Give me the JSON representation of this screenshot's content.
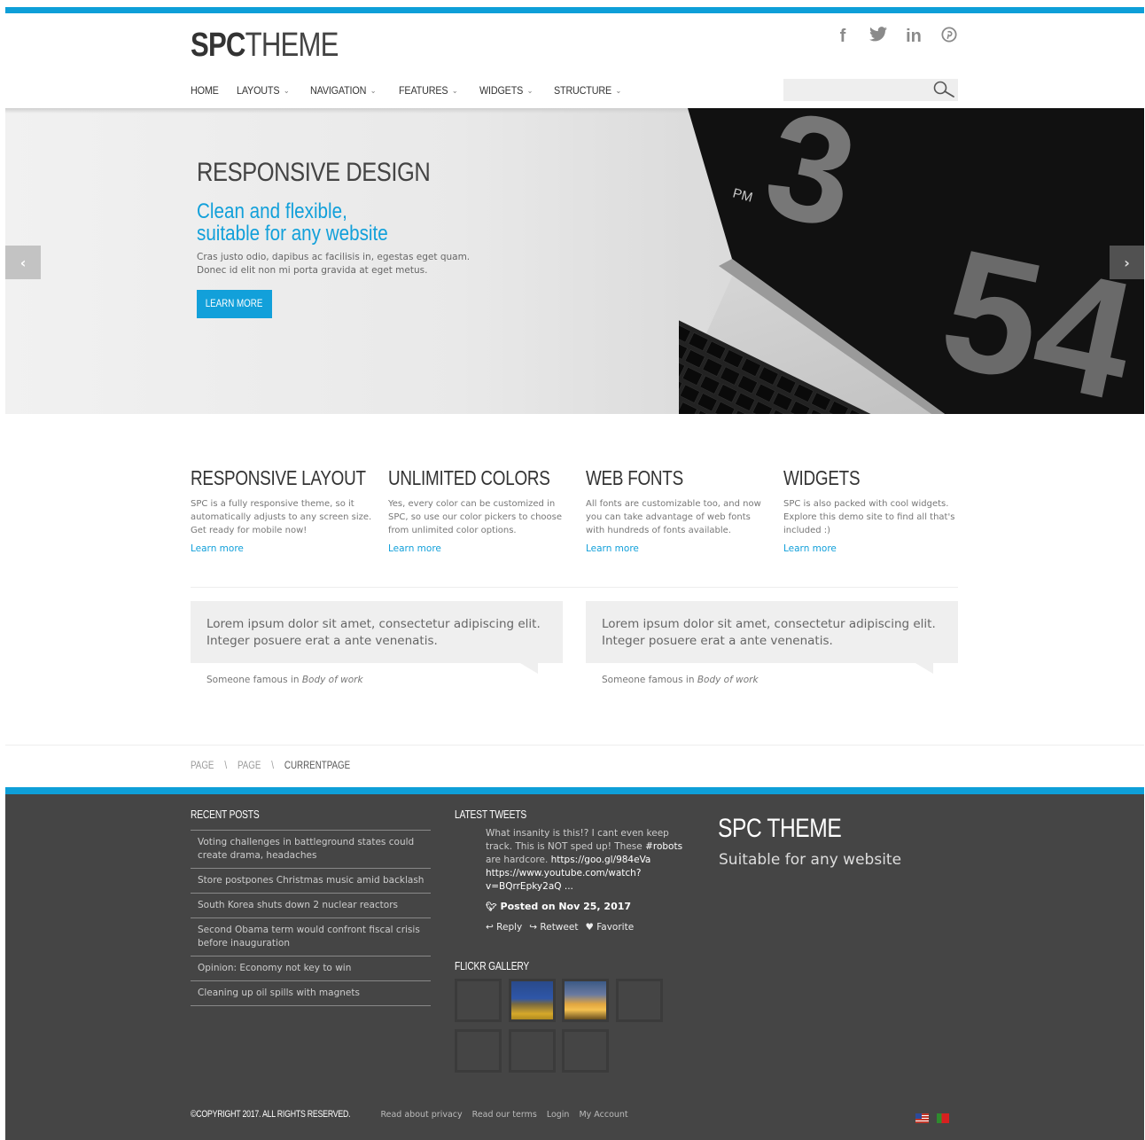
{
  "header": {
    "logo_bold": "SPC",
    "logo_light": "THEME",
    "social": [
      "facebook-icon",
      "twitter-icon",
      "linkedin-icon",
      "pinterest-icon"
    ],
    "social_glyphs": [
      "f",
      "𝕥",
      "in",
      "℗"
    ],
    "nav": [
      {
        "label": "HOME",
        "dropdown": false
      },
      {
        "label": "LAYOUTS",
        "dropdown": true
      },
      {
        "label": "NAVIGATION",
        "dropdown": true
      },
      {
        "label": "FEATURES",
        "dropdown": true
      },
      {
        "label": "WIDGETS",
        "dropdown": true
      },
      {
        "label": "STRUCTURE",
        "dropdown": true
      }
    ],
    "search_placeholder": ""
  },
  "hero": {
    "title": "RESPONSIVE DESIGN",
    "subtitle_line1": "Clean and flexible,",
    "subtitle_line2": "suitable for any website",
    "text_line1": "Cras justo odio, dapibus ac facilisis in, egestas eget quam.",
    "text_line2": "Donec id elit non mi porta gravida at eget metus.",
    "button": "LEARN MORE",
    "prev": "‹",
    "next": "›",
    "laptop_digits": [
      "3",
      "54"
    ],
    "laptop_pm": "PM"
  },
  "features": [
    {
      "title": "RESPONSIVE LAYOUT",
      "text": "SPC is a fully responsive theme, so it automatically adjusts to any screen size. Get ready for mobile now!",
      "link": "Learn more"
    },
    {
      "title": "UNLIMITED COLORS",
      "text": "Yes, every color can be customized in SPC, so use our color pickers to choose from unlimited color options.",
      "link": "Learn more"
    },
    {
      "title": "WEB FONTS",
      "text": "All fonts are customizable too, and now you can take advantage of web fonts with hundreds of fonts available.",
      "link": "Learn more"
    },
    {
      "title": "WIDGETS",
      "text": "SPC is also packed with cool widgets. Explore this demo site to find all that's included :)",
      "link": "Learn more"
    }
  ],
  "quotes": [
    {
      "text": "Lorem ipsum dolor sit amet, consectetur adipiscing elit. Integer posuere erat a ante venenatis.",
      "author": "Someone famous in",
      "source": "Body of work"
    },
    {
      "text": "Lorem ipsum dolor sit amet, consectetur adipiscing elit. Integer posuere erat a ante venenatis.",
      "author": "Someone famous in",
      "source": "Body of work"
    }
  ],
  "breadcrumb": [
    "PAGE",
    "\\",
    "PAGE",
    "\\",
    "CURRENTPAGE"
  ],
  "footer": {
    "recent_posts_title": "RECENT POSTS",
    "recent_posts": [
      "Voting challenges in battleground states could create drama, headaches",
      "Store postpones Christmas music amid backlash",
      "South Korea shuts down 2 nuclear reactors",
      "Second Obama term would confront fiscal crisis before inauguration",
      "Opinion: Economy not key to win",
      "Cleaning up oil spills with magnets"
    ],
    "latest_tweets_title": "LATEST TWEETS",
    "tweet_text": "What insanity is this!? I cant even keep track. This is NOT sped up! These",
    "tweet_tag": "#robots",
    "tweet_text2": "are hardcore.",
    "tweet_link1": "https://goo.gl/984eVa",
    "tweet_link2": "https://www.youtube.com/watch?v=BQrrEpky2aQ ...",
    "tweet_posted": "Posted on Nov 25, 2017",
    "tweet_reply": "Reply",
    "tweet_retweet": "Retweet",
    "tweet_favorite": "Favorite",
    "flickr_title": "FLICKR GALLERY",
    "brand": "SPC THEME",
    "tagline": "Suitable for any website",
    "copyright": "©COPYRIGHT 2017. ALL RIGHTS RESERVED.",
    "links": [
      "Read about privacy",
      "Read our terms",
      "Login",
      "My Account"
    ]
  },
  "colors": {
    "accent": "#12a0da",
    "footer_bg": "#454545",
    "text_dark": "#333333"
  }
}
